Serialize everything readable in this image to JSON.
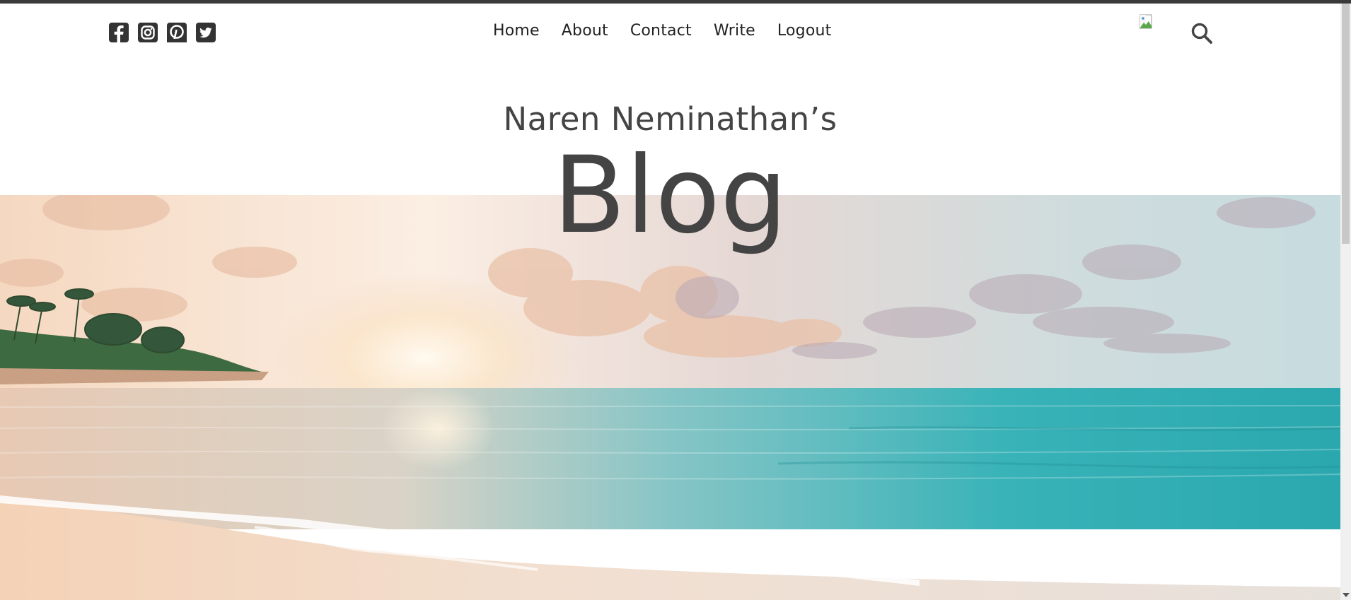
{
  "social": {
    "icons": [
      "facebook-square-icon",
      "instagram-square-icon",
      "pinterest-square-icon",
      "twitter-square-icon"
    ]
  },
  "nav": {
    "items": [
      {
        "label": "Home"
      },
      {
        "label": "About"
      },
      {
        "label": "Contact"
      },
      {
        "label": "Write"
      },
      {
        "label": "Logout"
      }
    ]
  },
  "user": {
    "avatar_icon": "broken-image-icon"
  },
  "search": {
    "icon": "search-icon"
  },
  "header": {
    "subtitle": "Naren Neminathan’s",
    "title": "Blog"
  },
  "hero": {
    "image": "beach-sunset-image"
  },
  "colors": {
    "text": "#444444",
    "nav_text": "#222222",
    "icons": "#333333"
  }
}
